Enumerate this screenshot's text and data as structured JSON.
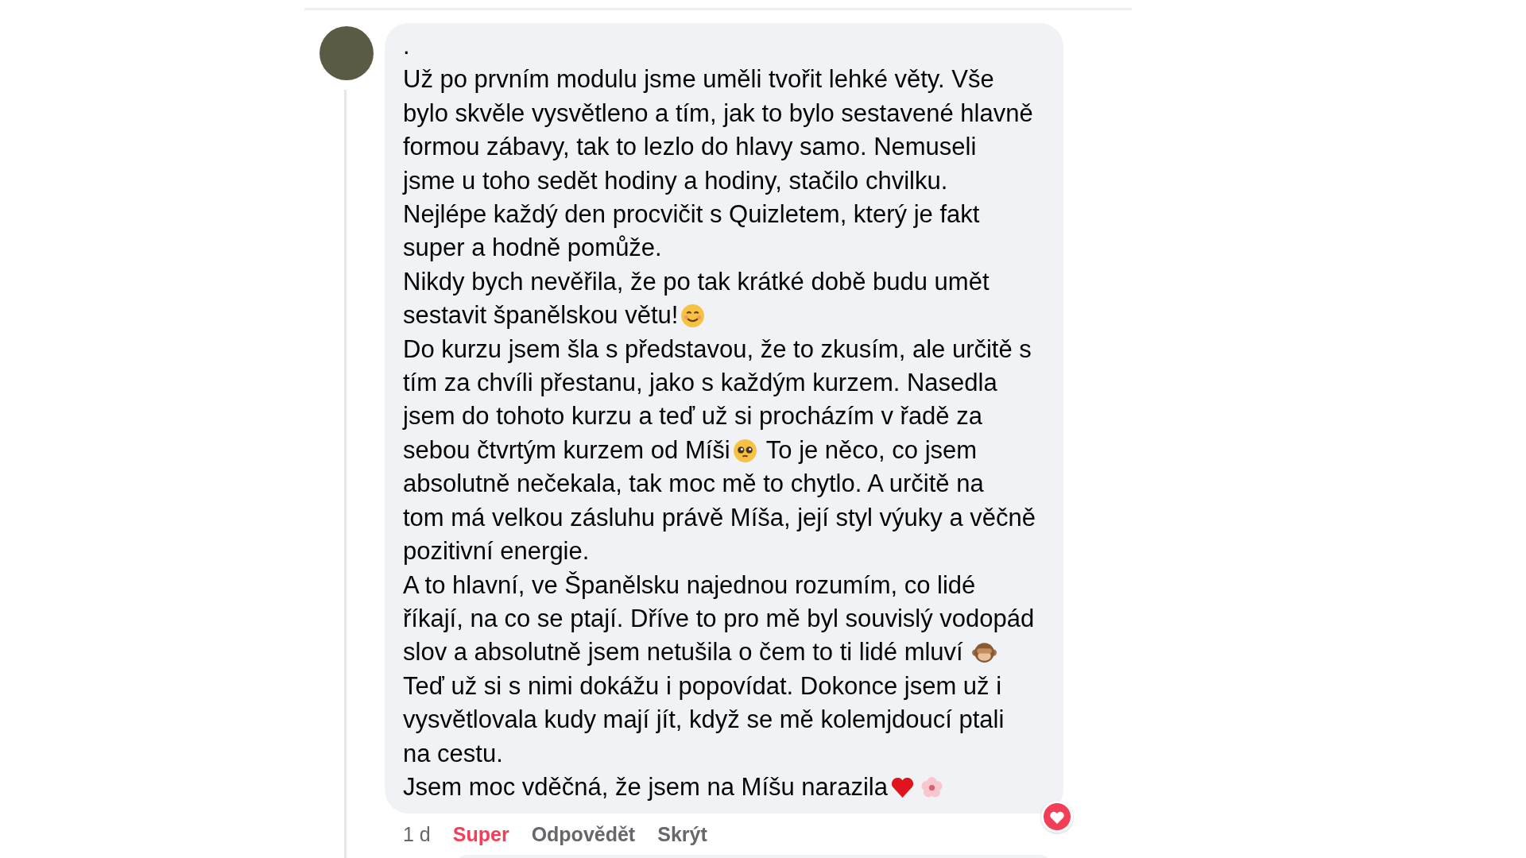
{
  "comment": {
    "lines": [
      [
        {
          "text": "."
        }
      ],
      [
        {
          "text": "Už po prvním modulu jsme uměli tvořit lehké věty. Vše"
        }
      ],
      [
        {
          "text": "bylo skvěle vysvětleno a tím, jak to bylo sestavené hlavně"
        }
      ],
      [
        {
          "text": "formou zábavy, tak to lezlo do hlavy samo. Nemuseli"
        }
      ],
      [
        {
          "text": "jsme u toho sedět hodiny a hodiny, stačilo chvilku."
        }
      ],
      [
        {
          "text": "Nejlépe každý den procvičit s Quizletem, který je fakt"
        }
      ],
      [
        {
          "text": "super a hodně pomůže."
        }
      ],
      [
        {
          "text": "Nikdy bych nevěřila, že po tak krátké době budu umět"
        }
      ],
      [
        {
          "text": "sestavit španělskou větu!"
        },
        {
          "kind": "smile"
        }
      ],
      [
        {
          "text": "Do kurzu jsem šla s představou, že to zkusím, ale určitě s"
        }
      ],
      [
        {
          "text": "tím za chvíli přestanu, jako s každým kurzem. Nasedla"
        }
      ],
      [
        {
          "text": "jsem do tohoto kurzu a teď už si procházím v řadě za"
        }
      ],
      [
        {
          "text": "sebou čtvrtým kurzem od Míši"
        },
        {
          "kind": "pleading"
        },
        {
          "text": " To je něco, co jsem"
        }
      ],
      [
        {
          "text": "absolutně nečekala, tak moc mě to chytlo. A určitě na"
        }
      ],
      [
        {
          "text": "tom má velkou zásluhu právě Míša, její styl výuky a věčně"
        }
      ],
      [
        {
          "text": "pozitivní energie."
        }
      ],
      [
        {
          "text": "A to hlavní, ve Španělsku najednou rozumím, co lidé"
        }
      ],
      [
        {
          "text": "říkají, na co se ptají. Dříve to pro mě byl souvislý vodopád"
        }
      ],
      [
        {
          "text": "slov a absolutně jsem netušila o čem to ti lidé mluví "
        },
        {
          "kind": "monkey"
        }
      ],
      [
        {
          "text": "Teď už si s nimi dokážu i popovídat. Dokonce jsem už i"
        }
      ],
      [
        {
          "text": "vysvětlovala kudy mají jít, když se mě kolemjdoucí ptali"
        }
      ],
      [
        {
          "text": "na cestu."
        }
      ],
      [
        {
          "text": "Jsem moc vděčná, že jsem na Míšu narazila"
        },
        {
          "kind": "heart"
        },
        {
          "kind": "blossom"
        }
      ]
    ],
    "reaction": {
      "kind": "love"
    },
    "time": "1 d",
    "actions": [
      {
        "label": "Super",
        "selected": true
      },
      {
        "label": "Odpovědět",
        "selected": false
      },
      {
        "label": "Skrýt",
        "selected": false
      }
    ]
  }
}
